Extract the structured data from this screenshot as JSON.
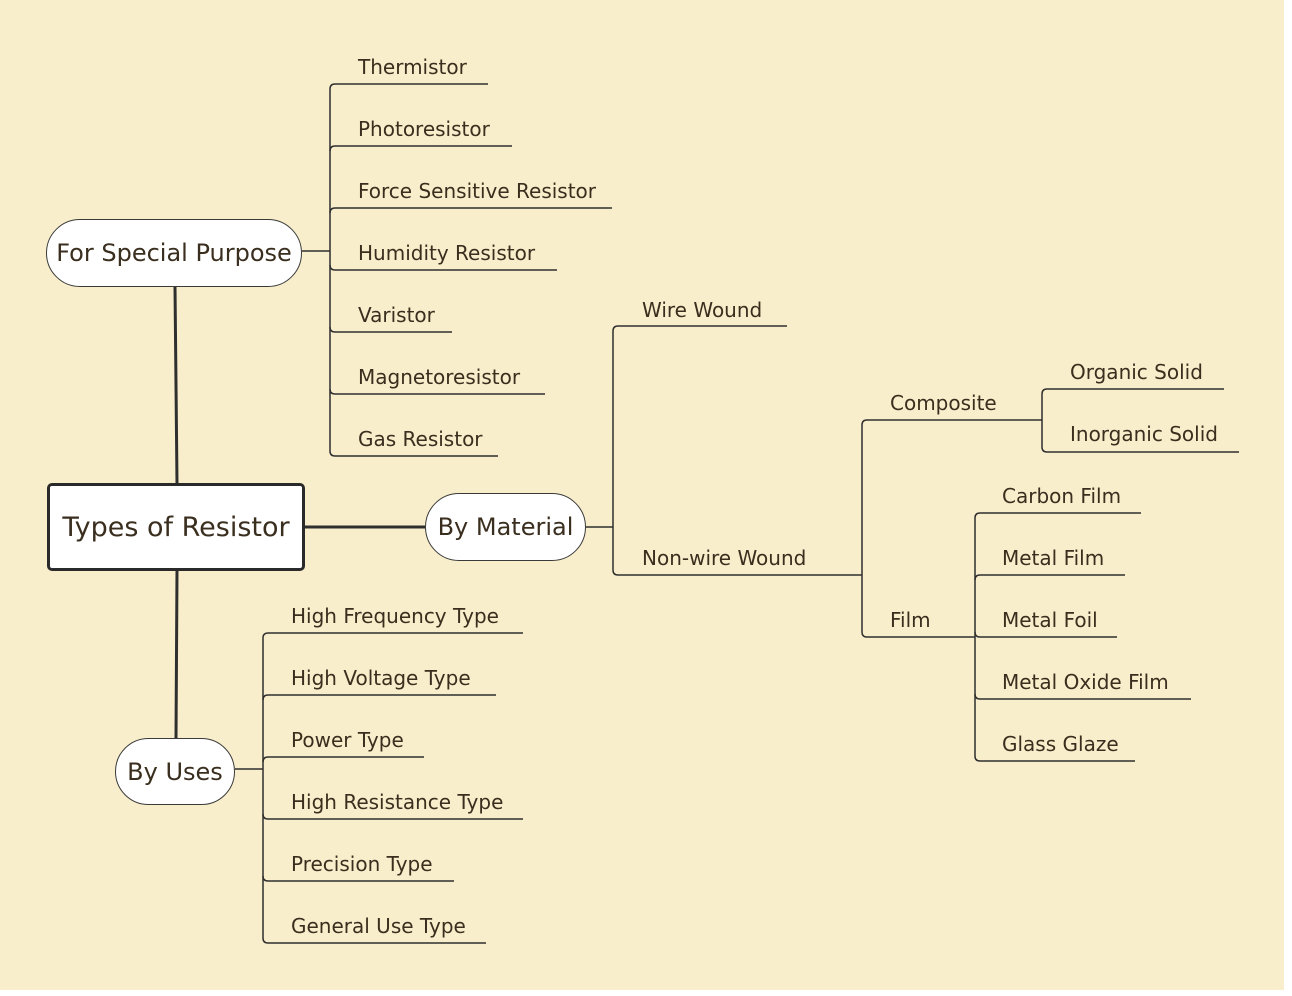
{
  "colors": {
    "background": "#f8eecb",
    "line": "#2f2f2f",
    "text": "#3a2e1e",
    "node_fill": "#ffffff"
  },
  "central": {
    "label": "Types of Resistor"
  },
  "branches": {
    "special": {
      "label": "For Special Purpose",
      "children": [
        "Thermistor",
        "Photoresistor",
        "Force Sensitive Resistor",
        "Humidity Resistor",
        "Varistor",
        "Magnetoresistor",
        "Gas Resistor"
      ]
    },
    "material": {
      "label": "By Material",
      "wire_wound": "Wire Wound",
      "non_wire_wound": {
        "label": "Non-wire Wound",
        "composite": {
          "label": "Composite",
          "children": [
            "Organic Solid",
            "Inorganic Solid"
          ]
        },
        "film": {
          "label": "Film",
          "children": [
            "Carbon Film",
            "Metal Film",
            "Metal Foil",
            "Metal Oxide Film",
            "Glass Glaze"
          ]
        }
      }
    },
    "uses": {
      "label": "By Uses",
      "children": [
        "High Frequency Type",
        "High Voltage Type",
        "Power Type",
        "High Resistance Type",
        "Precision Type",
        "General Use Type"
      ]
    }
  }
}
